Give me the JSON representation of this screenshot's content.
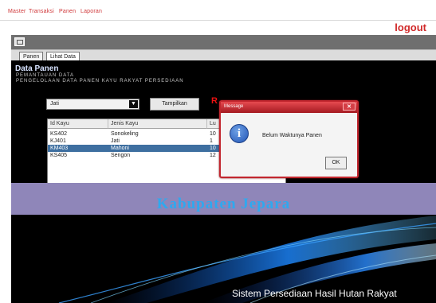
{
  "menu": {
    "items": [
      "Master",
      "Transaksi",
      "Panen",
      "Laporan"
    ]
  },
  "header": {
    "logout_label": "logout"
  },
  "tabs": [
    {
      "label": "Panen"
    },
    {
      "label": "Lihat Data"
    }
  ],
  "panel": {
    "title": "Data Panen",
    "subtitle_1": "PEMANTAUAN DATA",
    "subtitle_2": "PENGELOLAAN DATA PANEN KAYU RAKYAT PERSEDIAAN"
  },
  "controls": {
    "combo_value": "Jati",
    "combo_arrow": "▼",
    "show_button_label": "Tampilkan",
    "red_marker": "R"
  },
  "table": {
    "columns": [
      "Id Kayu",
      "Jenis Kayu",
      "Lu"
    ],
    "rows": [
      {
        "id": "KS402",
        "jenis": "Sonokeling",
        "lu": "10"
      },
      {
        "id": "KJ401",
        "jenis": "Jati",
        "lu": "1"
      },
      {
        "id": "KM403",
        "jenis": "Mahoni",
        "lu": "10"
      },
      {
        "id": "KS405",
        "jenis": "Sengon",
        "lu": "12"
      }
    ],
    "selected_index": 2,
    "scroll_left": "◂",
    "scroll_right": "▸"
  },
  "banner": {
    "text": "Kabupaten Jepara"
  },
  "footer": {
    "text": "Sistem Persediaan Hasil Hutan Rakyat"
  },
  "dialog": {
    "title": "Message",
    "close_glyph": "✕",
    "icon_glyph": "i",
    "message": "Belum Waktunya Panen",
    "ok_label": "OK"
  },
  "colors": {
    "accent_red": "#d12a2a",
    "banner_purple": "#8f86b9",
    "banner_text_blue": "#2ea9ef",
    "dialog_border_red": "#c2262e",
    "selection_blue": "#3e6fa0"
  }
}
